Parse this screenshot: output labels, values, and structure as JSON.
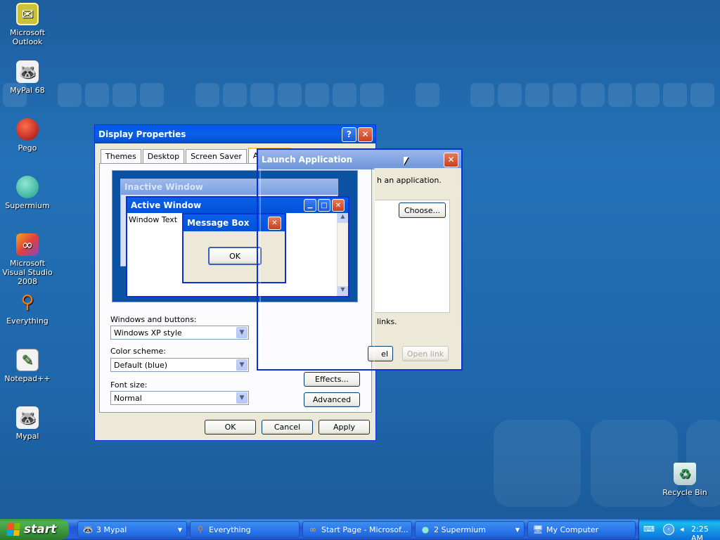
{
  "desktop": {
    "icons": [
      {
        "label": "Microsoft Outlook",
        "icon": "outlook-icon"
      },
      {
        "label": "MyPal 68",
        "icon": "mypal-icon"
      },
      {
        "label": "Pego",
        "icon": "pego-icon"
      },
      {
        "label": "Supermium",
        "icon": "supermium-icon"
      },
      {
        "label": "Microsoft Visual Studio 2008",
        "icon": "visual-studio-icon"
      },
      {
        "label": "Everything",
        "icon": "everything-icon"
      },
      {
        "label": "Notepad++",
        "icon": "notepadpp-icon"
      },
      {
        "label": "Mypal",
        "icon": "mypal-icon"
      },
      {
        "label": "Recycle Bin",
        "icon": "recycle-bin-icon"
      }
    ]
  },
  "display_properties": {
    "title": "Display Properties",
    "help_glyph": "?",
    "close_glyph": "✕",
    "tabs": [
      "Themes",
      "Desktop",
      "Screen Saver",
      "Appeara"
    ],
    "preview": {
      "inactive_title": "Inactive Window",
      "active_title": "Active Window",
      "window_text": "Window Text",
      "message_box_title": "Message Box",
      "ok_label": "OK"
    },
    "windows_buttons_label": "Windows and buttons:",
    "windows_buttons_value": "Windows XP style",
    "color_scheme_label": "Color scheme:",
    "color_scheme_value": "Default (blue)",
    "font_size_label": "Font size:",
    "font_size_value": "Normal",
    "effects_label": "Effects...",
    "advanced_label": "Advanced",
    "ok_label": "OK",
    "cancel_label": "Cancel",
    "apply_label": "Apply"
  },
  "launch_application": {
    "title": "Launch Application",
    "close_glyph": "✕",
    "intro_text": "h an application.",
    "choose_label": "Choose...",
    "links_text": "links.",
    "cancel_fragment": "el",
    "open_link_label": "Open link"
  },
  "taskbar": {
    "start_label": "start",
    "items": [
      {
        "label": "3 Mypal",
        "icon": "mypal-icon",
        "group": true
      },
      {
        "label": "Everything",
        "icon": "everything-icon",
        "group": false
      },
      {
        "label": "Start Page - Microsof...",
        "icon": "visual-studio-icon",
        "group": false
      },
      {
        "label": "2 Supermium",
        "icon": "supermium-icon",
        "group": true
      },
      {
        "label": "My Computer",
        "icon": "my-computer-icon",
        "group": false
      }
    ],
    "clock": "2:25 AM"
  },
  "colors": {
    "title_blue": "#0058e6",
    "window_face": "#ece9d8",
    "start_green": "#3c9a3c",
    "close_red": "#d2522d"
  }
}
